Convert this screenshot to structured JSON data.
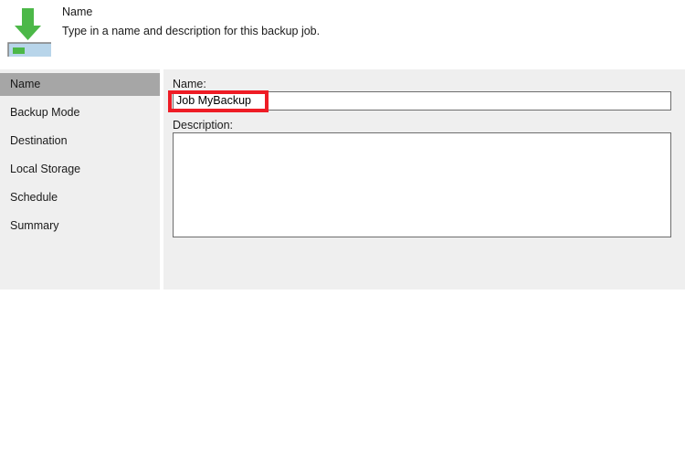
{
  "header": {
    "icon_name": "download-to-disk-icon",
    "title": "Name",
    "subtitle": "Type in a name and description for this backup job."
  },
  "sidebar": {
    "items": [
      {
        "label": "Name",
        "selected": true
      },
      {
        "label": "Backup Mode",
        "selected": false
      },
      {
        "label": "Destination",
        "selected": false
      },
      {
        "label": "Local Storage",
        "selected": false
      },
      {
        "label": "Schedule",
        "selected": false
      },
      {
        "label": "Summary",
        "selected": false
      }
    ]
  },
  "content": {
    "name_label": "Name:",
    "name_value": "Job MyBackup",
    "name_placeholder": "",
    "description_label": "Description:",
    "description_value": "",
    "description_placeholder": ""
  },
  "annotation": {
    "color": "#ee1c25",
    "target": "name-input"
  },
  "colors": {
    "panel_background": "#efefef",
    "selection_background": "#a6a6a6",
    "field_border": "#6d6d6d",
    "arrow_green": "#4cb848",
    "drive_blue": "#b8d5ea",
    "page_background": "#ffffff"
  }
}
